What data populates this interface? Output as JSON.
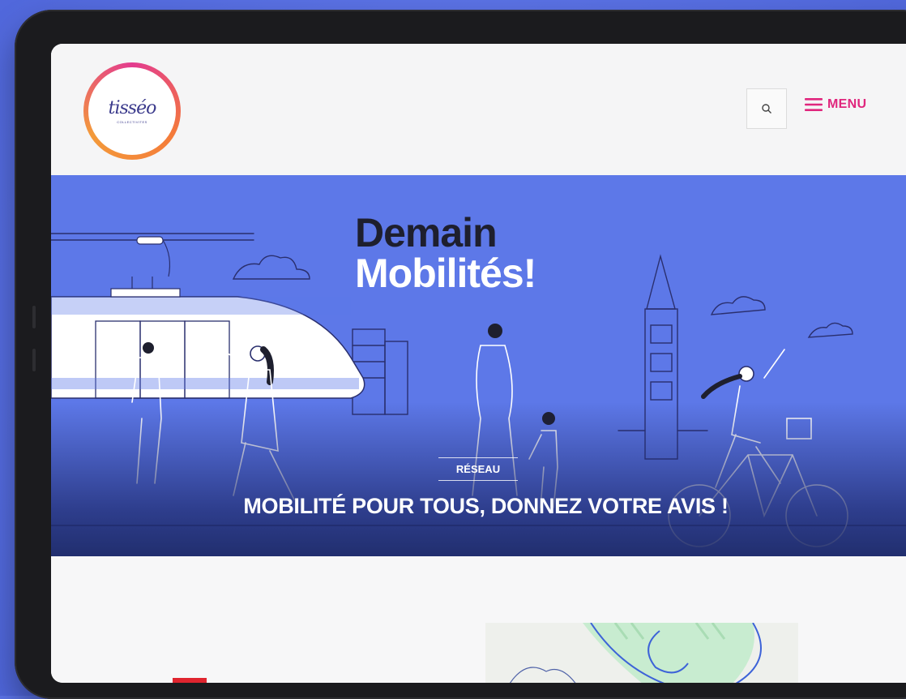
{
  "brand": {
    "logo_text": "tisséo",
    "logo_subtext": "COLLECTIVITES"
  },
  "header": {
    "search_icon": "search-icon",
    "menu_icon": "hamburger-icon",
    "menu_label": "MENU"
  },
  "hero": {
    "title_line1": "Demain",
    "title_line2": "Mobilités!",
    "category": "RÉSEAU",
    "headline": "MOBILITÉ POUR TOUS, DONNEZ VOTRE AVIS !"
  },
  "colors": {
    "accent": "#e0267d",
    "hero_bg": "#5d78e8",
    "background": "#5b73e6"
  }
}
